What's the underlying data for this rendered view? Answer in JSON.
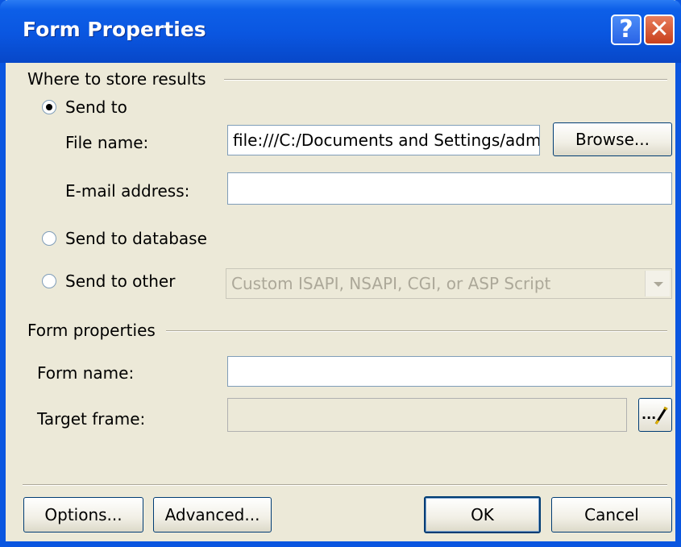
{
  "window": {
    "title": "Form Properties"
  },
  "titlebar": {
    "help_label": "?",
    "close_label": "✕"
  },
  "store_section": {
    "heading": "Where to store results",
    "send_to_label": "Send to",
    "file_name_label": "File name:",
    "file_name_value": "file:///C:/Documents and Settings/admir",
    "browse_label": "Browse...",
    "email_label": "E-mail address:",
    "email_value": "",
    "send_to_database_label": "Send to database",
    "send_to_other_label": "Send to other",
    "other_select_value": "Custom ISAPI, NSAPI, CGI, or ASP Script",
    "selected_option": "Send to"
  },
  "form_section": {
    "heading": "Form properties",
    "form_name_label": "Form name:",
    "form_name_value": "",
    "target_frame_label": "Target frame:",
    "target_frame_value": "",
    "target_frame_button_label": "..."
  },
  "buttons": {
    "options_label": "Options...",
    "advanced_label": "Advanced...",
    "ok_label": "OK",
    "cancel_label": "Cancel"
  }
}
